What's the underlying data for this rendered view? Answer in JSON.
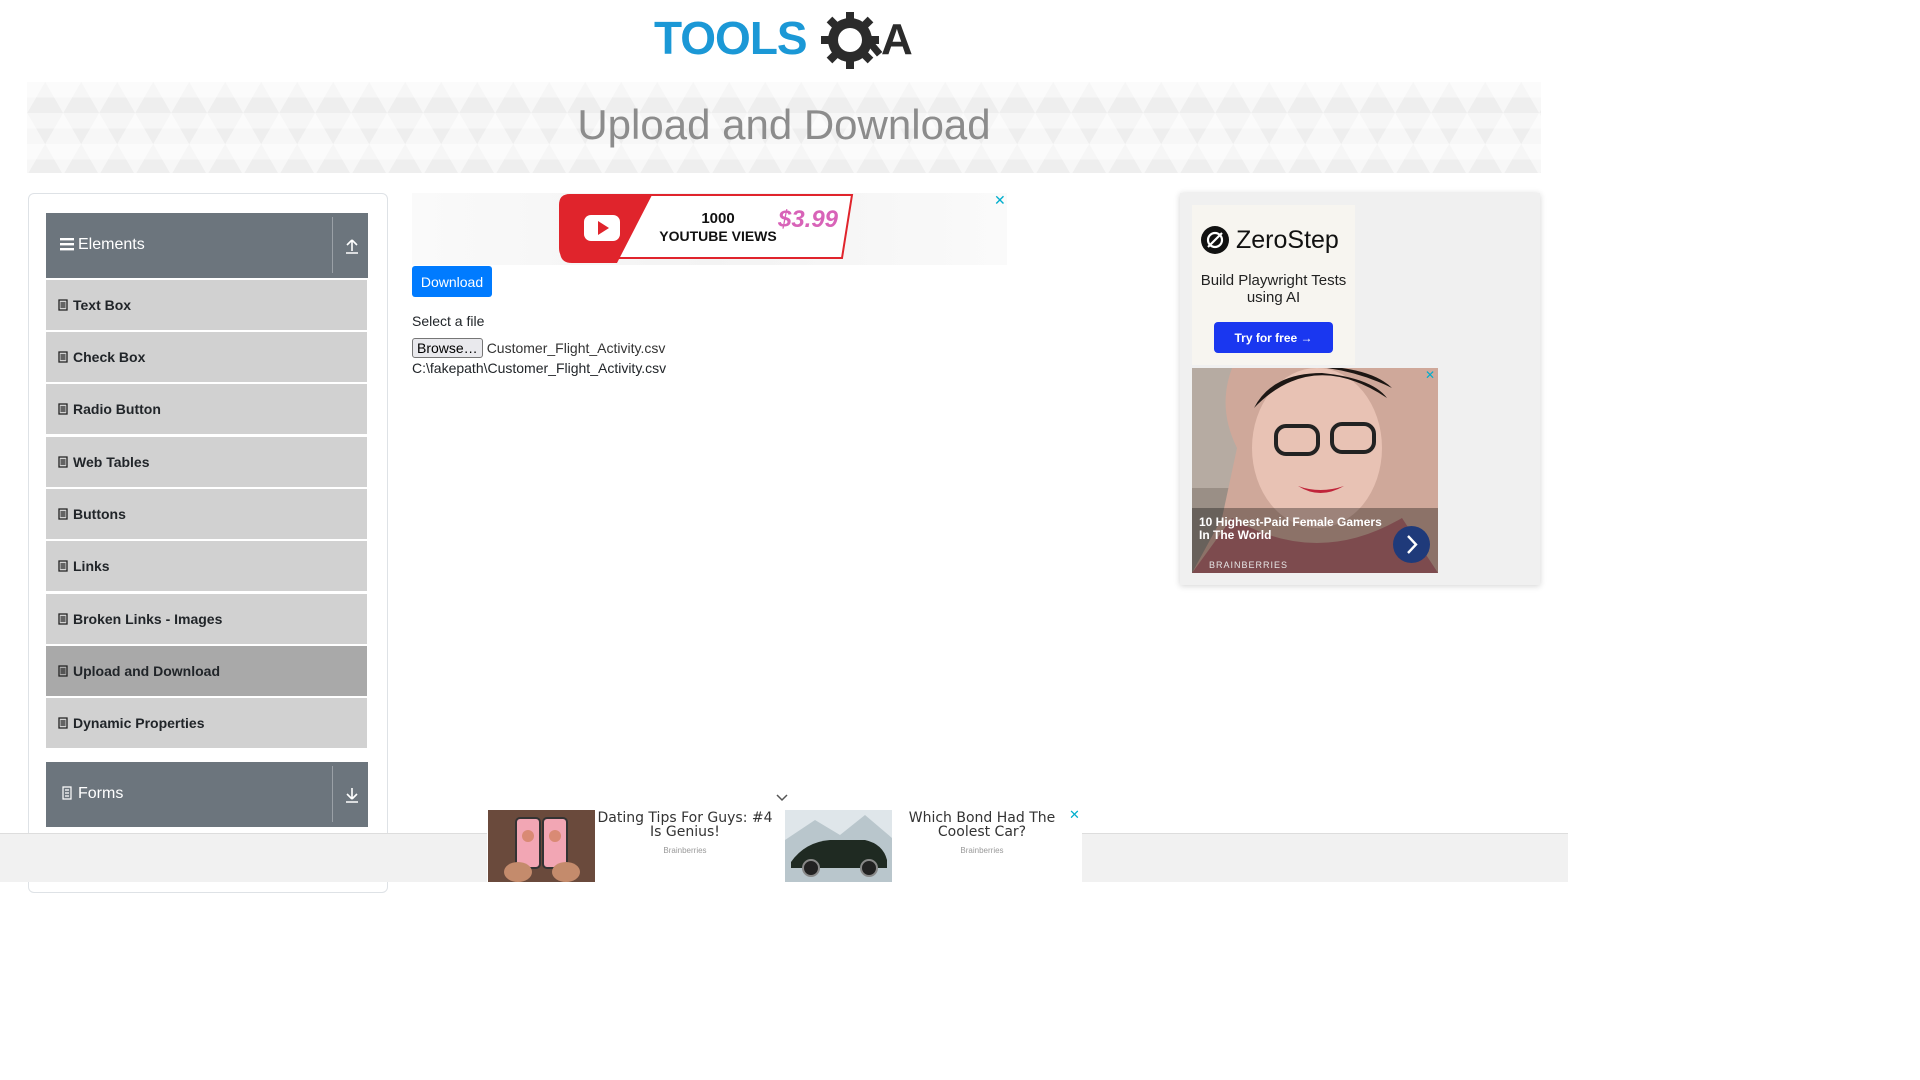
{
  "header": {
    "logo_text_blue": "TOOLS",
    "logo_text_dark": "QA",
    "logo_icon": "gear-magnifier-icon"
  },
  "page": {
    "title": "Upload and Download"
  },
  "sidebar": {
    "groups": [
      {
        "label": "Elements",
        "icon": "hamburger-icon",
        "toggle_icon": "upload-arrow-icon",
        "expanded": true
      },
      {
        "label": "Forms",
        "icon": "document-icon",
        "toggle_icon": "download-arrow-icon",
        "expanded": false
      }
    ],
    "items": [
      {
        "label": "Text Box",
        "active": false
      },
      {
        "label": "Check Box",
        "active": false
      },
      {
        "label": "Radio Button",
        "active": false
      },
      {
        "label": "Web Tables",
        "active": false
      },
      {
        "label": "Buttons",
        "active": false
      },
      {
        "label": "Links",
        "active": false
      },
      {
        "label": "Broken Links - Images",
        "active": false
      },
      {
        "label": "Upload and Download",
        "active": true
      },
      {
        "label": "Dynamic Properties",
        "active": false
      }
    ]
  },
  "main": {
    "download_label": "Download",
    "select_file_label": "Select a file",
    "browse_label": "Browse…",
    "selected_file_name": "Customer_Flight_Activity.csv",
    "uploaded_path": "C:\\fakepath\\Customer_Flight_Activity.csv"
  },
  "ads": {
    "top": {
      "line1": "1000",
      "line2": "YOUTUBE VIEWS",
      "price": "$3.99",
      "close": "✕"
    },
    "zerostep": {
      "name": "ZeroStep",
      "tagline": "Build Playwright Tests using AI",
      "cta": "Try for free →"
    },
    "brainberries": {
      "headline": "10 Highest-Paid Female Gamers In The World",
      "source": "BRAINBERRIES",
      "close": "✕"
    },
    "bottom": [
      {
        "title": "Dating Tips For Guys: #4 Is Genius!",
        "source": "Brainberries"
      },
      {
        "title": "Which Bond Had The Coolest Car?",
        "source": "Brainberries"
      }
    ],
    "bottom_close": "✕"
  },
  "colors": {
    "brand_blue": "#1b98d6",
    "sidebar_header": "#6c757d",
    "menu_item": "#d1d1d1",
    "menu_item_active": "#a9a9a9",
    "primary_button": "#007bff"
  }
}
